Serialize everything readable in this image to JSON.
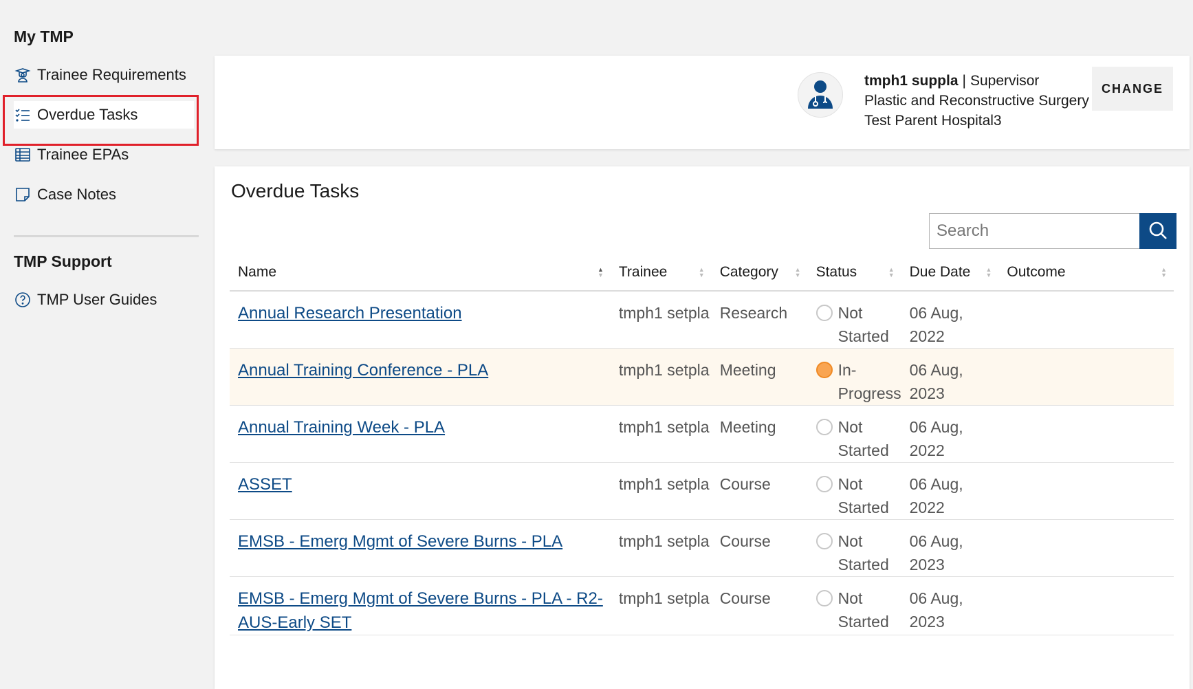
{
  "sidebar": {
    "heading": "My TMP",
    "items": [
      {
        "label": "Trainee Requirements",
        "icon": "graduate-icon"
      },
      {
        "label": "Overdue Tasks",
        "icon": "checklist-icon"
      },
      {
        "label": "Trainee EPAs",
        "icon": "table-icon"
      },
      {
        "label": "Case Notes",
        "icon": "note-icon"
      }
    ],
    "support_heading": "TMP Support",
    "support_items": [
      {
        "label": "TMP User Guides",
        "icon": "help-circle-icon"
      }
    ]
  },
  "profile": {
    "name": "tmph1 suppla",
    "separator": "|",
    "role": "Supervisor",
    "specialty": "Plastic and Reconstructive Surgery",
    "hospital": "Test Parent Hospital3",
    "change_label": "CHANGE"
  },
  "main": {
    "title": "Overdue Tasks",
    "search_placeholder": "Search",
    "columns": [
      "Name",
      "Trainee",
      "Category",
      "Status",
      "Due Date",
      "Outcome"
    ],
    "rows": [
      {
        "name": "Annual Research Presentation",
        "trainee": "tmph1 setpla",
        "category": "Research",
        "status": "Not Started",
        "due": "06 Aug, 2022",
        "outcome": ""
      },
      {
        "name": "Annual Training Conference - PLA",
        "trainee": "tmph1 setpla",
        "category": "Meeting",
        "status": "In-Progress",
        "due": "06 Aug, 2023",
        "outcome": ""
      },
      {
        "name": "Annual Training Week - PLA",
        "trainee": "tmph1 setpla",
        "category": "Meeting",
        "status": "Not Started",
        "due": "06 Aug, 2022",
        "outcome": ""
      },
      {
        "name": "ASSET",
        "trainee": "tmph1 setpla",
        "category": "Course",
        "status": "Not Started",
        "due": "06 Aug, 2022",
        "outcome": ""
      },
      {
        "name": "EMSB - Emerg Mgmt of Severe Burns - PLA",
        "trainee": "tmph1 setpla",
        "category": "Course",
        "status": "Not Started",
        "due": "06 Aug, 2023",
        "outcome": ""
      },
      {
        "name": "EMSB - Emerg Mgmt of Severe Burns - PLA - R2-AUS-Early SET",
        "trainee": "tmph1 setpla",
        "category": "Course",
        "status": "Not Started",
        "due": "06 Aug, 2023",
        "outcome": ""
      }
    ]
  },
  "colors": {
    "accent": "#0d4a86",
    "highlight_row": "#fef8ee",
    "in_progress": "#f08a24",
    "annotation_red": "#e0202a"
  }
}
